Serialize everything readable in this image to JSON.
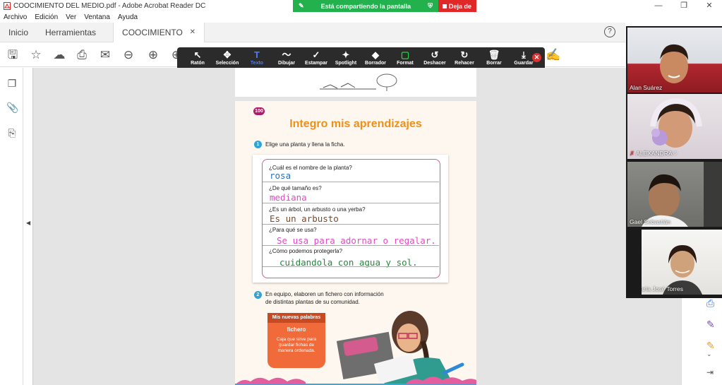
{
  "window": {
    "title": "COOCIMIENTO DEL MEDIO.pdf - Adobe Acrobat Reader DC",
    "minimize": "—",
    "maximize": "❐",
    "close": "✕"
  },
  "share_banner": {
    "text": "Está compartiendo la pantalla",
    "stop_label": "Deja de"
  },
  "menu": [
    "Archivo",
    "Edición",
    "Ver",
    "Ventana",
    "Ayuda"
  ],
  "tabs": {
    "home": "Inicio",
    "tools": "Herramientas",
    "document": "COOCIMIENTO DE...",
    "close": "✕",
    "help": "?"
  },
  "annotation_tools": [
    {
      "label": "Ratón",
      "glyph": "↖"
    },
    {
      "label": "Selección",
      "glyph": "✥"
    },
    {
      "label": "Texto",
      "glyph": "T"
    },
    {
      "label": "Dibujar",
      "glyph": "〜"
    },
    {
      "label": "Estampar",
      "glyph": "✓"
    },
    {
      "label": "Spotlight",
      "glyph": "✦"
    },
    {
      "label": "Borrador",
      "glyph": "◆"
    },
    {
      "label": "Format",
      "glyph": "▢"
    },
    {
      "label": "Deshacer",
      "glyph": "↺"
    },
    {
      "label": "Rehacer",
      "glyph": "↻"
    },
    {
      "label": "Borrar",
      "glyph": "🗑"
    },
    {
      "label": "Guardar",
      "glyph": "⤓"
    }
  ],
  "annotation_close": "✕",
  "page": {
    "number": "100",
    "title": "Integro mis aprendizajes",
    "step1_num": "1",
    "step1_text": "Elige una planta y llena la ficha.",
    "questions": [
      {
        "q": "¿Cuál es el nombre de la planta?",
        "a": "rosa",
        "color": "#2a6fb8"
      },
      {
        "q": "¿De qué tamaño es?",
        "a": "mediana",
        "color": "#e04bc4"
      },
      {
        "q": "¿Es un árbol, un arbusto o una yerba?",
        "a": "Es un arbusto",
        "color": "#7a4a2a"
      },
      {
        "q": "¿Para qué se usa?",
        "a": "Se usa para adornar o regalar.",
        "color": "#e04bc4"
      },
      {
        "q": "¿Cómo podemos protegerla?",
        "a": "cuidandola con agua y sol.",
        "color": "#1e8a3a"
      }
    ],
    "step2_num": "2",
    "step2_line1": "En equipo, elaboren un fichero con información",
    "step2_line2": "de distintas plantas de su comunidad.",
    "box_header": "Mis nuevas palabras",
    "box_word": "fichero",
    "box_def": "Caja que sirve para guardar fichas de manera ordenada."
  },
  "participants": [
    {
      "name": "Alan Suárez",
      "muted": false
    },
    {
      "name": "ALEXANDRA♡",
      "muted": true
    },
    {
      "name": "Gael Sebastián",
      "muted": false
    },
    {
      "name": "María José Torres",
      "muted": true
    }
  ]
}
